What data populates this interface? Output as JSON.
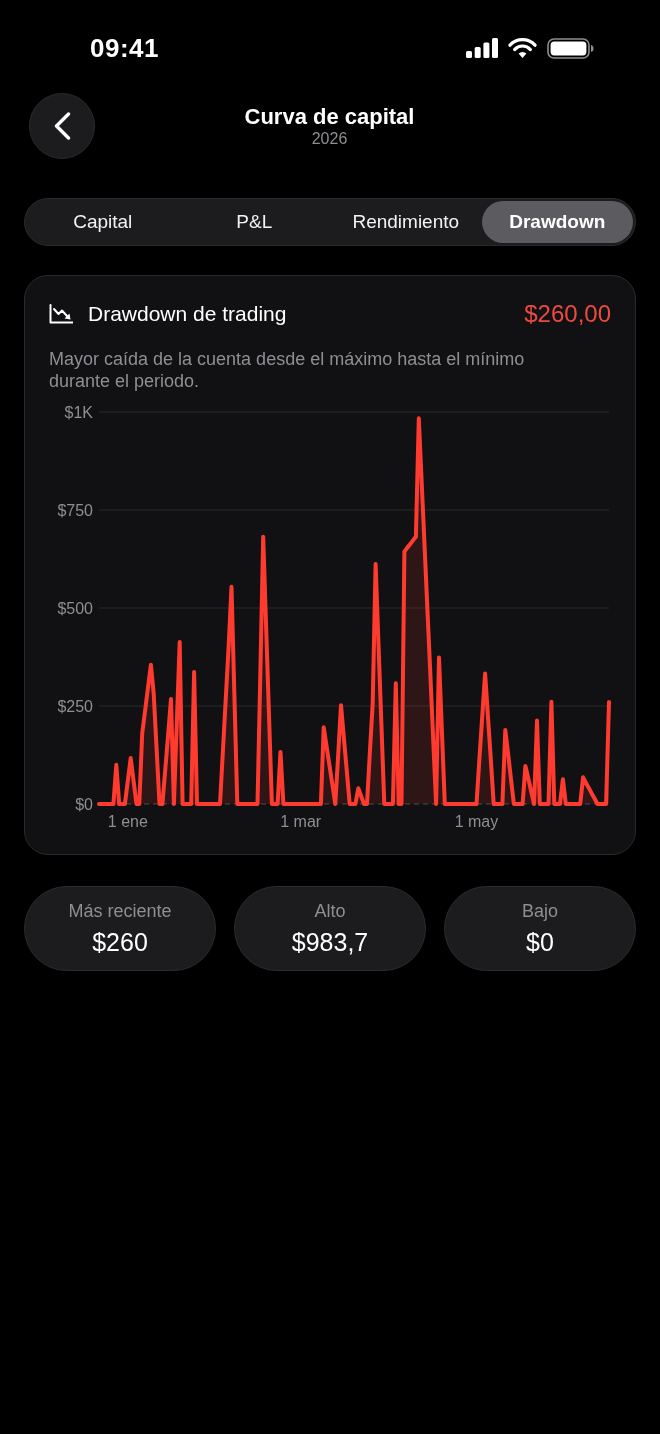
{
  "status_bar": {
    "time": "09:41"
  },
  "header": {
    "title": "Curva de capital",
    "subtitle": "2026"
  },
  "tabs": [
    {
      "label": "Capital",
      "selected": false
    },
    {
      "label": "P&L",
      "selected": false
    },
    {
      "label": "Rendimiento",
      "selected": false
    },
    {
      "label": "Drawdown",
      "selected": true
    }
  ],
  "card": {
    "title": "Drawdown de trading",
    "value": "$260,00",
    "description": "Mayor caída de la cuenta desde el máximo hasta el mínimo durante el periodo.",
    "chart_data": {
      "type": "area",
      "grid": true,
      "categories": [
        null,
        null,
        null,
        null,
        null,
        null,
        null,
        null,
        null,
        null,
        "1 ene",
        null,
        null,
        null,
        null,
        null,
        null,
        null,
        null,
        null,
        null,
        null,
        null,
        null,
        null,
        null,
        null,
        null,
        null,
        null,
        null,
        null,
        null,
        null,
        null,
        null,
        null,
        null,
        null,
        null,
        null,
        null,
        null,
        null,
        null,
        null,
        null,
        null,
        null,
        null,
        null,
        null,
        null,
        null,
        null,
        null,
        null,
        null,
        null,
        null,
        null,
        null,
        null,
        null,
        null,
        null,
        null,
        null,
        null,
        null,
        "1 mar",
        null,
        null,
        null,
        null,
        null,
        null,
        null,
        null,
        null,
        null,
        null,
        null,
        null,
        null,
        null,
        null,
        null,
        null,
        null,
        null,
        null,
        null,
        null,
        null,
        null,
        null,
        null,
        null,
        null,
        null,
        null,
        null,
        null,
        null,
        null,
        null,
        null,
        null,
        null,
        null,
        null,
        null,
        null,
        null,
        null,
        null,
        null,
        null,
        null,
        null,
        null,
        null,
        null,
        null,
        null,
        null,
        null,
        null,
        null,
        null,
        "1 may",
        null,
        null,
        null,
        null,
        null,
        null,
        null,
        null,
        null,
        null,
        null,
        null,
        null,
        null,
        null,
        null,
        null,
        null,
        null,
        null,
        null,
        null,
        null,
        null,
        null,
        null,
        null,
        null,
        null,
        null,
        null,
        null,
        null,
        null,
        null,
        null,
        null,
        null,
        null,
        null,
        null,
        null,
        null,
        null,
        null,
        null
      ],
      "series": [
        {
          "color": "#ff3b30",
          "values": [
            0,
            0,
            0,
            0,
            0,
            0,
            100,
            0,
            0,
            0,
            59,
            117,
            59,
            0,
            0,
            180,
            238,
            297,
            355,
            282,
            141,
            0,
            0,
            89,
            179,
            268,
            0,
            207,
            413,
            0,
            0,
            0,
            0,
            337,
            0,
            0,
            0,
            0,
            0,
            0,
            0,
            0,
            0,
            135,
            270,
            405,
            554,
            277,
            0,
            0,
            0,
            0,
            0,
            0,
            0,
            0,
            341,
            682,
            455,
            227,
            0,
            0,
            0,
            133,
            0,
            0,
            0,
            0,
            0,
            0,
            0,
            0,
            0,
            0,
            0,
            0,
            0,
            0,
            196,
            147,
            98,
            49,
            0,
            126,
            252,
            168,
            84,
            0,
            0,
            0,
            40,
            20,
            0,
            0,
            129,
            257,
            612,
            408,
            204,
            0,
            0,
            0,
            0,
            308,
            0,
            0,
            644,
            654,
            663,
            673,
            682,
            984,
            820,
            656,
            492,
            328,
            164,
            0,
            374,
            187,
            0,
            0,
            0,
            0,
            0,
            0,
            0,
            0,
            0,
            0,
            0,
            0,
            111,
            222,
            333,
            222,
            111,
            0,
            0,
            0,
            0,
            189,
            126,
            63,
            0,
            0,
            0,
            0,
            97,
            65,
            32,
            0,
            213,
            0,
            0,
            0,
            0,
            261,
            0,
            0,
            0,
            63,
            0,
            0,
            0,
            0,
            0,
            0,
            68,
            54,
            41,
            27,
            14,
            0,
            0,
            0,
            0,
            260
          ]
        }
      ],
      "ylim": [
        0,
        1000
      ],
      "yticks": [
        {
          "value": 0,
          "label": "$0"
        },
        {
          "value": 250,
          "label": "$250"
        },
        {
          "value": 500,
          "label": "$500"
        },
        {
          "value": 750,
          "label": "$750"
        },
        {
          "value": 1000,
          "label": "$1K"
        }
      ]
    }
  },
  "stats": [
    {
      "label": "Más reciente",
      "value": "$260"
    },
    {
      "label": "Alto",
      "value": "$983,7"
    },
    {
      "label": "Bajo",
      "value": "$0"
    }
  ]
}
